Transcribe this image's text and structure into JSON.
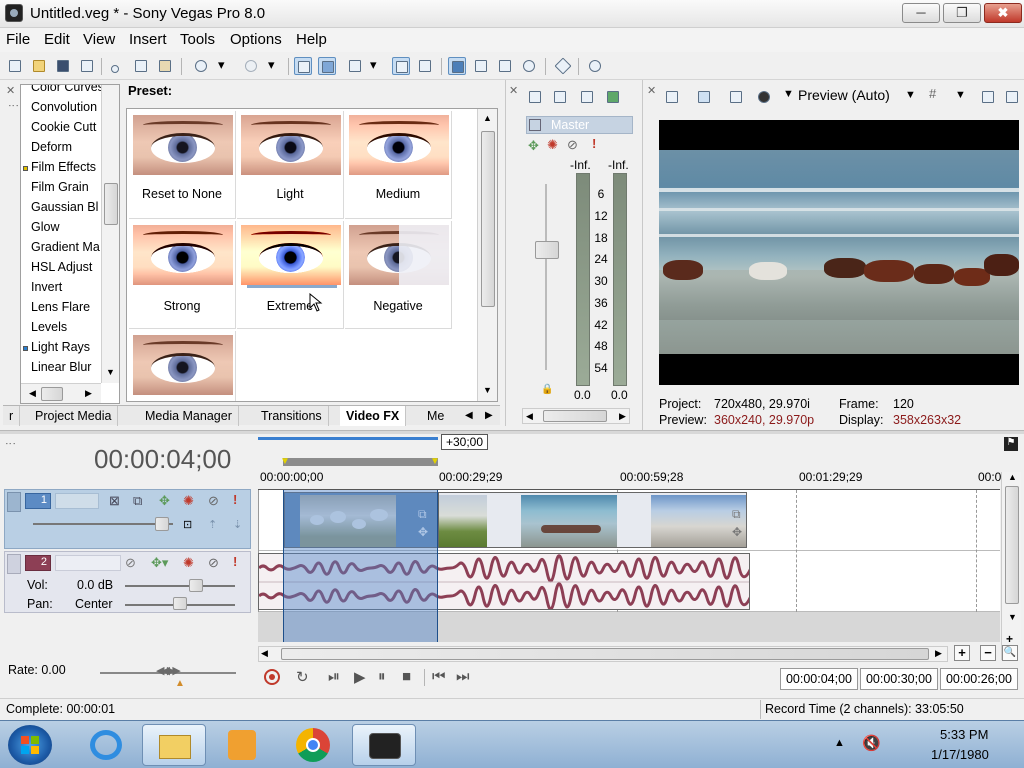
{
  "window": {
    "title": "Untitled.veg * - Sony Vegas Pro 8.0",
    "min": "─",
    "max": "❐",
    "close": "✖"
  },
  "menu": [
    "File",
    "Edit",
    "View",
    "Insert",
    "Tools",
    "Options",
    "Help"
  ],
  "toolbar_icons": [
    "new-icon",
    "open-icon",
    "save-icon",
    "properties-icon",
    "cut-icon",
    "copy-icon",
    "paste-icon",
    "undo-icon",
    "redo-icon",
    "auto-ripple-icon",
    "snapping-icon",
    "lock-envelopes-icon",
    "normal-edit-tool-icon",
    "envelope-tool-icon",
    "selection-tool-icon",
    "zoom-tool-icon",
    "split-icon",
    "help-icon"
  ],
  "fx_list": {
    "items": [
      {
        "label": "Color Curves",
        "marked": false
      },
      {
        "label": "Convolution",
        "marked": false
      },
      {
        "label": "Cookie Cutt",
        "marked": false
      },
      {
        "label": "Deform",
        "marked": false
      },
      {
        "label": "Film Effects",
        "marked": true,
        "mark_color": "#e0c000"
      },
      {
        "label": "Film Grain",
        "marked": false
      },
      {
        "label": "Gaussian Bl",
        "marked": false
      },
      {
        "label": "Glow",
        "marked": false
      },
      {
        "label": "Gradient Ma",
        "marked": false
      },
      {
        "label": "HSL Adjust",
        "marked": false
      },
      {
        "label": "Invert",
        "marked": false
      },
      {
        "label": "Lens Flare",
        "marked": false
      },
      {
        "label": "Levels",
        "marked": false
      },
      {
        "label": "Light Rays",
        "marked": true,
        "mark_color": "#2a7fd0"
      },
      {
        "label": "Linear Blur",
        "marked": false
      }
    ]
  },
  "presets": {
    "heading": "Preset:",
    "items": [
      {
        "label": "Reset to None",
        "style": "normal"
      },
      {
        "label": "Light",
        "style": "light"
      },
      {
        "label": "Medium",
        "style": "medium"
      },
      {
        "label": "Strong",
        "style": "strong"
      },
      {
        "label": "Extreme",
        "style": "extreme"
      },
      {
        "label": "Negative",
        "style": "negative"
      },
      {
        "label": "",
        "style": "normal"
      }
    ]
  },
  "tabs": [
    "r",
    "Project Media",
    "Media Manager",
    "Transitions",
    "Video FX",
    "Me"
  ],
  "mixer": {
    "master_label": "Master",
    "peak_left": "-Inf.",
    "peak_right": "-Inf.",
    "scale": [
      "6",
      "12",
      "18",
      "24",
      "30",
      "36",
      "42",
      "48",
      "54"
    ],
    "value_left": "0.0",
    "value_right": "0.0"
  },
  "preview": {
    "mode": "Preview (Auto)",
    "project_label": "Project:",
    "project_value": "720x480, 29.970i",
    "frame_label": "Frame:",
    "frame_value": "120",
    "preview_label": "Preview:",
    "preview_value": "360x240, 29.970p",
    "display_label": "Display:",
    "display_value": "358x263x32",
    "value_color": "#8b1a1a"
  },
  "timeline": {
    "timecode": "00:00:04;00",
    "selection_length": "+30;00",
    "ruler": [
      "00:00:00;00",
      "00:00:29;29",
      "00:00:59;28",
      "00:01:29;29",
      "00:0"
    ],
    "track1_number": "1",
    "track2_number": "2",
    "vol_label": "Vol:",
    "vol_value": "0.0 dB",
    "pan_label": "Pan:",
    "pan_value": "Center"
  },
  "transport": {
    "rate": "Rate: 0.00",
    "tc_cursor": "00:00:04;00",
    "tc_end": "00:00:30;00",
    "tc_length": "00:00:26;00"
  },
  "status": {
    "complete": "Complete: 00:00:01",
    "record_time": "Record Time (2 channels): 33:05:50"
  },
  "taskbar": {
    "time": "5:33 PM",
    "date": "1/17/1980"
  },
  "colors": {
    "selection": "#6f9ccf",
    "track_header_video": "#b9cfe4",
    "track_header_audio": "#e4e6ee",
    "waveform": "#8d3f55"
  }
}
